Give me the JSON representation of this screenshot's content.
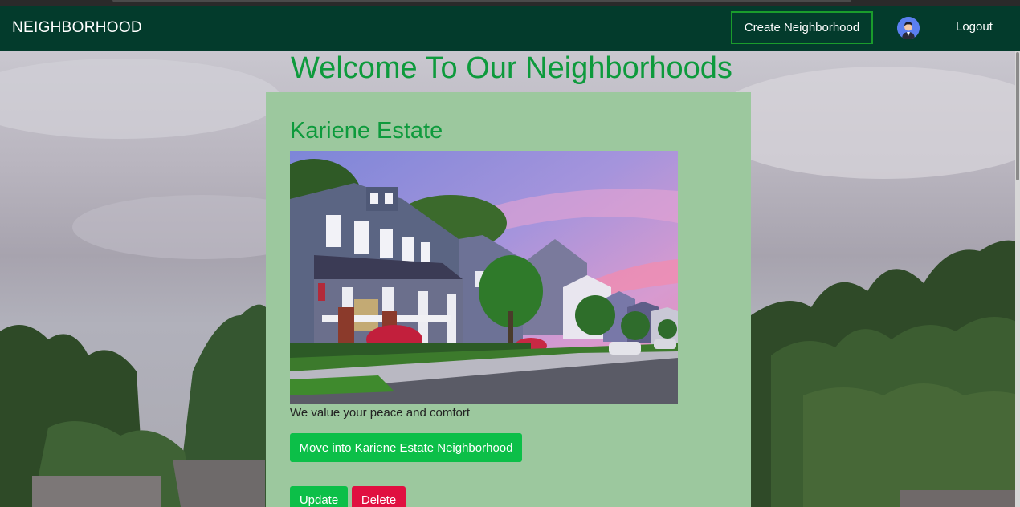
{
  "navbar": {
    "brand": "NEIGHBORHOOD",
    "create_label": "Create Neighborhood",
    "logout_label": "Logout"
  },
  "main": {
    "heading": "Welcome To Our Neighborhoods"
  },
  "neighborhood": {
    "name": "Kariene Estate",
    "description": "We value your peace and comfort",
    "move_label": "Move into Kariene Estate Neighborhood",
    "update_label": "Update",
    "delete_label": "Delete"
  },
  "colors": {
    "navbar": "#033b2c",
    "accent_green": "#0d9a3c",
    "card_bg": "#9cc89e",
    "button_green": "#0cbf48",
    "button_red": "#e01040"
  }
}
